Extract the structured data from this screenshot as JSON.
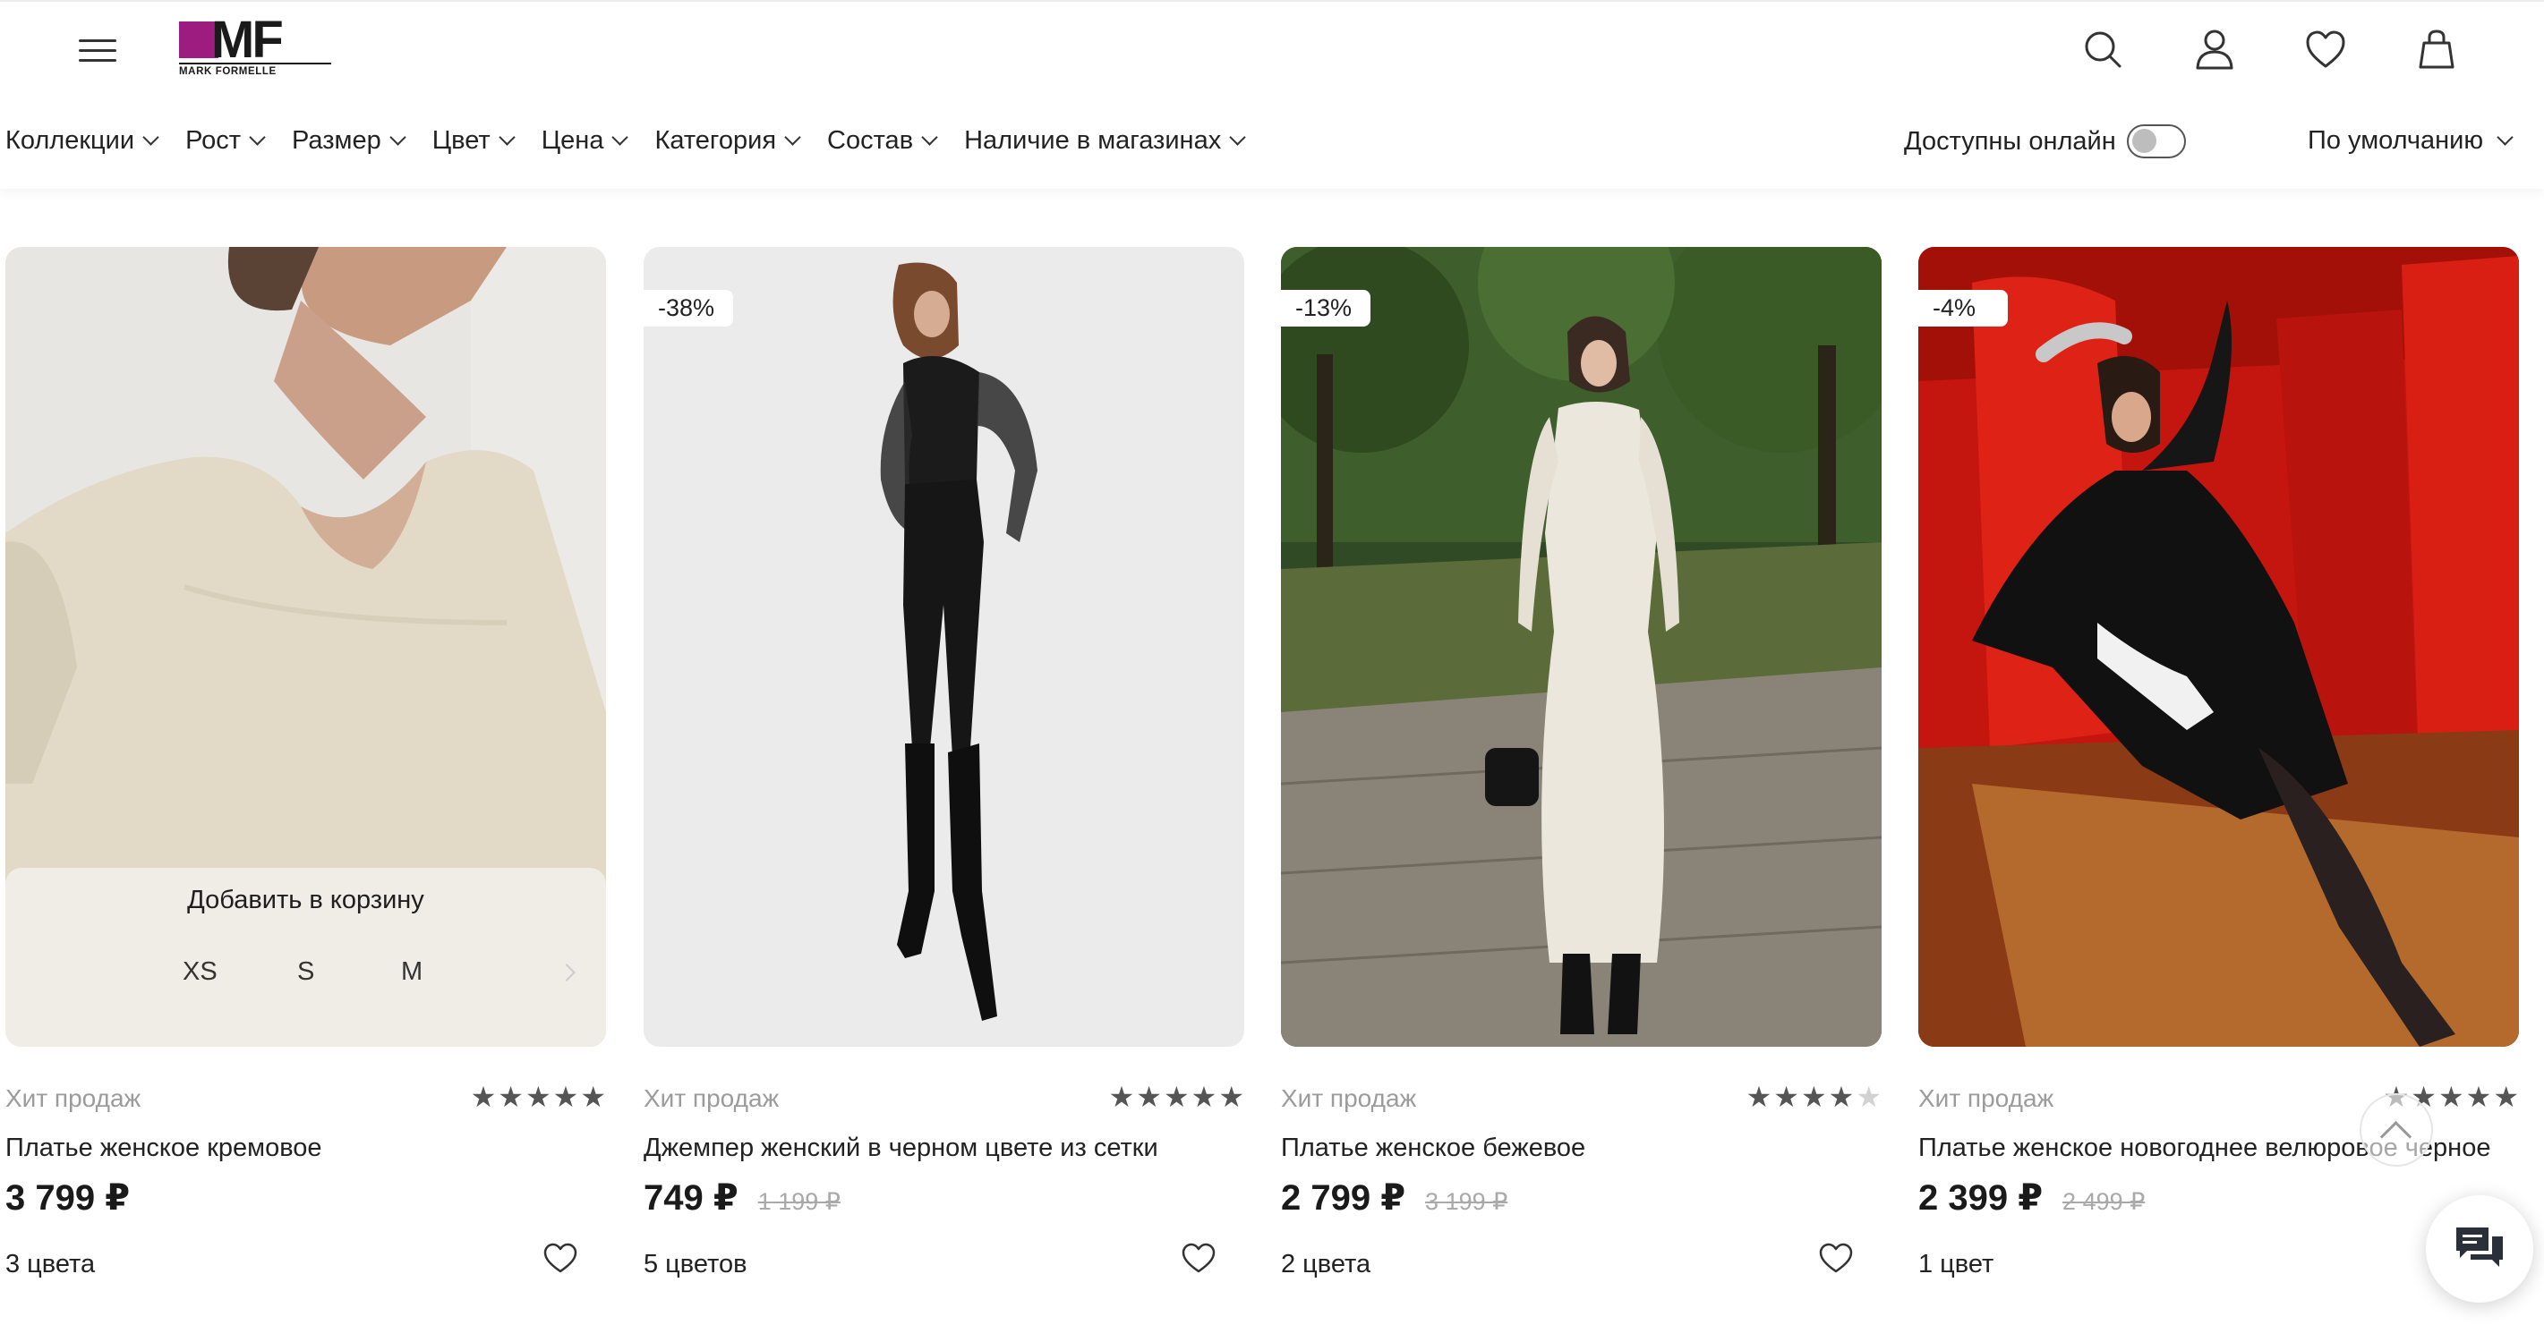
{
  "header": {
    "logo_text": "MF",
    "logo_subtitle": "MARK FORMELLE",
    "icons": [
      "menu-icon",
      "search-icon",
      "account-icon",
      "favorites-heart-icon",
      "cart-bag-icon"
    ]
  },
  "filters": {
    "items": [
      {
        "label": "Коллекции"
      },
      {
        "label": "Рост"
      },
      {
        "label": "Размер"
      },
      {
        "label": "Цвет"
      },
      {
        "label": "Цена"
      },
      {
        "label": "Категория"
      },
      {
        "label": "Состав"
      },
      {
        "label": "Наличие в магазинах"
      }
    ],
    "online_label": "Доступны онлайн",
    "online_enabled": false,
    "sort_label": "По умолчанию"
  },
  "products": [
    {
      "badge": "",
      "tag": "Хит продаж",
      "rating": 5,
      "name": "Платье женское кремовое",
      "price": "3 799 ₽",
      "old_price": "",
      "colors": "3 цвета",
      "add_to_cart": "Добавить в корзину",
      "sizes": [
        "XS",
        "S",
        "M"
      ]
    },
    {
      "badge": "-38%",
      "tag": "Хит продаж",
      "rating": 5,
      "name": "Джемпер женский в черном цвете из сетки",
      "price": "749 ₽",
      "old_price": "1 199 ₽",
      "colors": "5 цветов"
    },
    {
      "badge": "-13%",
      "tag": "Хит продаж",
      "rating": 4,
      "name": "Платье женское бежевое",
      "price": "2 799 ₽",
      "old_price": "3 199 ₽",
      "colors": "2 цвета"
    },
    {
      "badge": "-4%",
      "tag": "Хит продаж",
      "rating": 5,
      "name": "Платье женское новогоднее велюровое черное",
      "price": "2 399 ₽",
      "old_price": "2 499 ₽",
      "colors": "1 цвет"
    }
  ],
  "colors": {
    "brand": "#9c1c7f",
    "text": "#1e1e1e",
    "muted": "#9b9b9b",
    "old_price": "#a9a9a9",
    "star": "#555555"
  }
}
